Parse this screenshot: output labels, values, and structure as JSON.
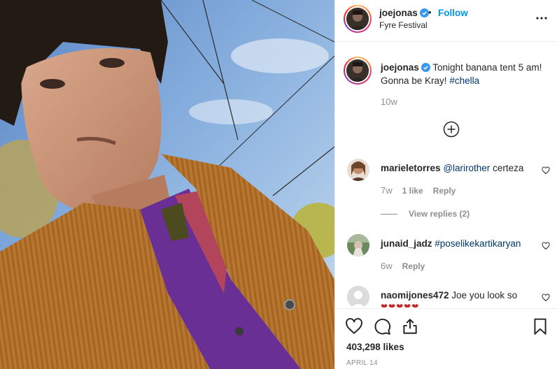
{
  "post": {
    "author": {
      "username": "joejonas",
      "verified": true,
      "follow_label": "Follow",
      "separator": "•",
      "location": "Fyre Festival"
    },
    "caption": {
      "username": "joejonas",
      "text": "Tonight banana tent 5 am! Gonna be Kray! ",
      "hashtag": "#chella",
      "age": "10w"
    },
    "comments": [
      {
        "username": "marieletorres",
        "mention": "@larirother",
        "text": " certeza",
        "age": "7w",
        "likes": "1 like",
        "reply_label": "Reply",
        "view_replies": "View replies (2)"
      },
      {
        "username": "junaid_jadz",
        "hashtag": "#poselikekartikaryan",
        "text": "",
        "age": "6w",
        "reply_label": "Reply"
      },
      {
        "username": "naomijones472",
        "text": " Joe you look so"
      }
    ],
    "likes_count": "403,298 likes",
    "date": "APRIL 14"
  },
  "icons": {
    "more": "more-options-icon",
    "load_more": "add-circle-icon",
    "like": "heart-icon",
    "comment": "comment-icon",
    "share": "share-icon",
    "save": "bookmark-icon"
  },
  "colors": {
    "accent": "#0095f6",
    "link": "#00376b",
    "muted": "#8e8e8e",
    "verified": "#3897f0"
  }
}
